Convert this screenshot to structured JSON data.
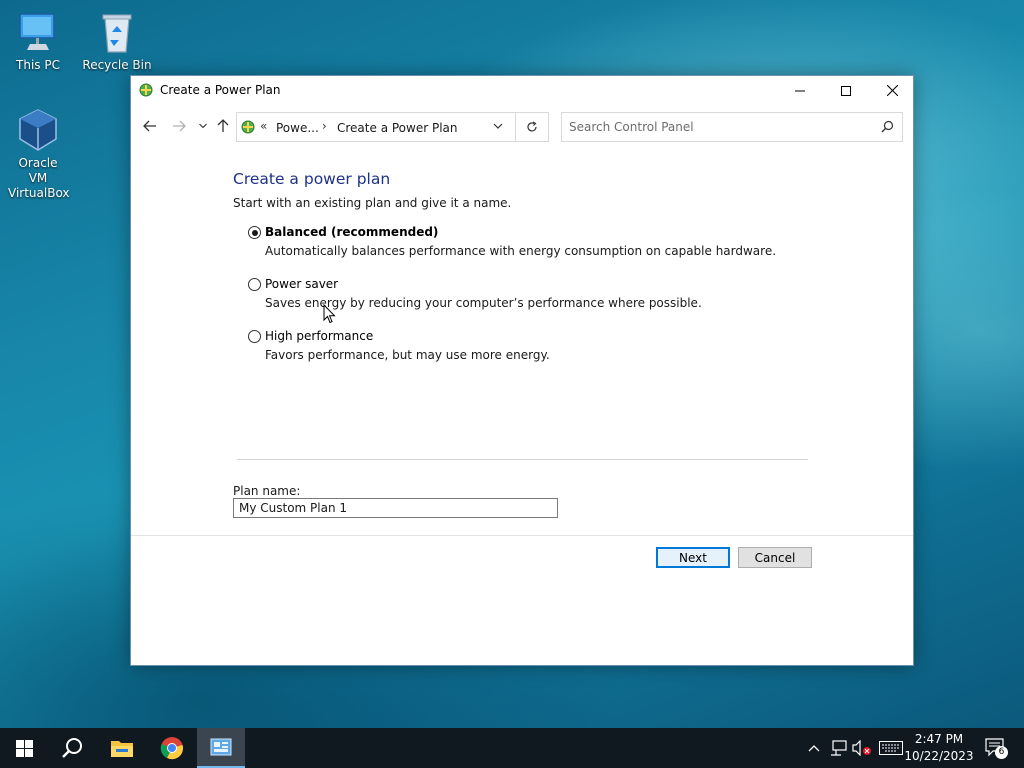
{
  "desktop": {
    "icons": [
      {
        "label": "This PC"
      },
      {
        "label": "Recycle Bin"
      },
      {
        "label": "Oracle VM VirtualBox"
      }
    ]
  },
  "window": {
    "title": "Create a Power Plan",
    "address": {
      "overflow_glyph": "«",
      "crumbs": [
        "Powe...",
        "Create a Power Plan"
      ],
      "separator": "›"
    },
    "search": {
      "placeholder": "Search Control Panel"
    }
  },
  "content": {
    "heading": "Create a power plan",
    "subtitle": "Start with an existing plan and give it a name.",
    "options": [
      {
        "label": "Balanced (recommended)",
        "description": "Automatically balances performance with energy consumption on capable hardware.",
        "selected": true
      },
      {
        "label": "Power saver",
        "description": "Saves energy by reducing your computer’s performance where possible.",
        "selected": false
      },
      {
        "label": "High performance",
        "description": "Favors performance, but may use more energy.",
        "selected": false
      }
    ],
    "plan_name_label": "Plan name:",
    "plan_name_value": "My Custom Plan 1",
    "next_label": "Next",
    "cancel_label": "Cancel"
  },
  "taskbar": {
    "time": "2:47 PM",
    "date": "10/22/2023",
    "notification_count": "6"
  },
  "colors": {
    "heading": "#1e3287",
    "accent": "#0078d7",
    "taskbar": "#101820"
  }
}
